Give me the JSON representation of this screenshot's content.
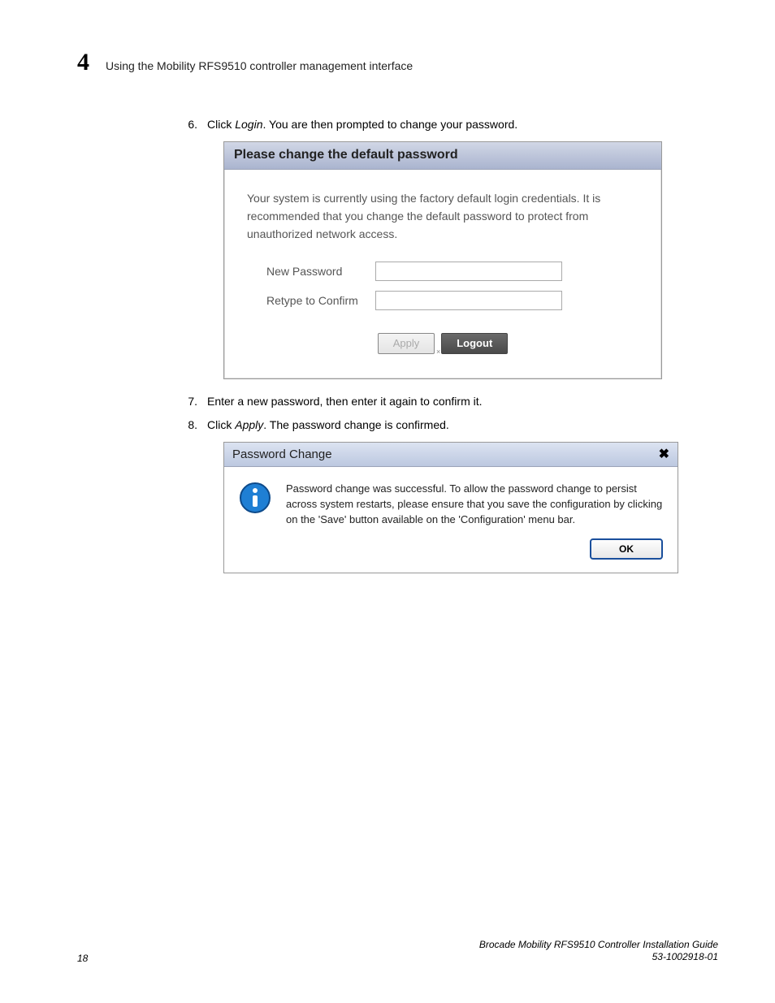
{
  "header": {
    "chapter_number": "4",
    "chapter_title": "Using the Mobility RFS9510 controller management interface"
  },
  "steps": {
    "s6_num": "6.",
    "s6_prefix": "Click ",
    "s6_em": "Login",
    "s6_suffix": ". You are then prompted to change your password.",
    "s7_num": "7.",
    "s7_text": "Enter a new password, then enter it again to confirm it.",
    "s8_num": "8.",
    "s8_prefix": "Click ",
    "s8_em": "Apply",
    "s8_suffix": ". The password change is confirmed."
  },
  "dialog1": {
    "title": "Please change the default password",
    "body_text": "Your system is currently using the factory default login credentials. It is recommended that you change the default password to protect from unauthorized network access.",
    "new_password_label": "New Password",
    "retype_label": "Retype to Confirm",
    "apply_btn": "Apply",
    "logout_btn": "Logout",
    "tiny_x": "×"
  },
  "dialog2": {
    "title": "Password Change",
    "close": "✖",
    "body_text": "Password change was successful. To allow the password change to persist across system restarts, please ensure that you save the configuration by clicking on the 'Save' button available on the 'Configuration' menu bar.",
    "ok_btn": "OK"
  },
  "footer": {
    "page_number": "18",
    "guide_title": "Brocade Mobility RFS9510 Controller Installation Guide",
    "doc_number": "53-1002918-01"
  }
}
